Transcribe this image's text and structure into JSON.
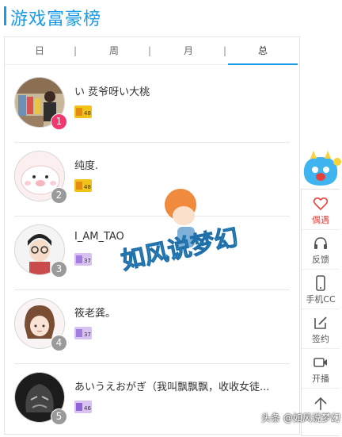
{
  "header": {
    "title": "游戏富豪榜"
  },
  "tabs": [
    {
      "label": "日",
      "active": false
    },
    {
      "label": "周",
      "active": false
    },
    {
      "label": "月",
      "active": false
    },
    {
      "label": "总",
      "active": true
    }
  ],
  "tab_separator": "|",
  "rows": [
    {
      "rank": "1",
      "name": "い 烎爷呀い大桃",
      "badge_level": "48",
      "badge_icon": "gold-level-badge-icon"
    },
    {
      "rank": "2",
      "name": "纯度.",
      "badge_level": "48",
      "badge_icon": "gold-level-badge-icon"
    },
    {
      "rank": "3",
      "name": "I_AM_TAO",
      "badge_level": "37",
      "badge_icon": "purple-level-badge-icon"
    },
    {
      "rank": "4",
      "name": "筱老龚。",
      "badge_level": "37",
      "badge_icon": "purple-level-badge-icon"
    },
    {
      "rank": "5",
      "name": "あいうえおがぎ（我叫飘飘飘，收收女徒...",
      "badge_level": "46",
      "badge_icon": "purple-level-badge-icon"
    }
  ],
  "sidebar": {
    "items": [
      {
        "label": "偶遇",
        "icon": "heart-icon"
      },
      {
        "label": "反馈",
        "icon": "headset-icon"
      },
      {
        "label": "手机CC",
        "icon": "phone-icon"
      },
      {
        "label": "签约",
        "icon": "edit-icon"
      },
      {
        "label": "开播",
        "icon": "video-icon"
      },
      {
        "label": "",
        "icon": "arrow-up-icon"
      }
    ]
  },
  "watermark": {
    "logo_text": "如风说梦幻",
    "caption": "头条 @如风说梦幻"
  },
  "colors": {
    "accent": "#1a9be6",
    "rank_top": "#f0386e",
    "rank_other": "#9a9a9a",
    "sidebar_highlight": "#e8413b"
  }
}
